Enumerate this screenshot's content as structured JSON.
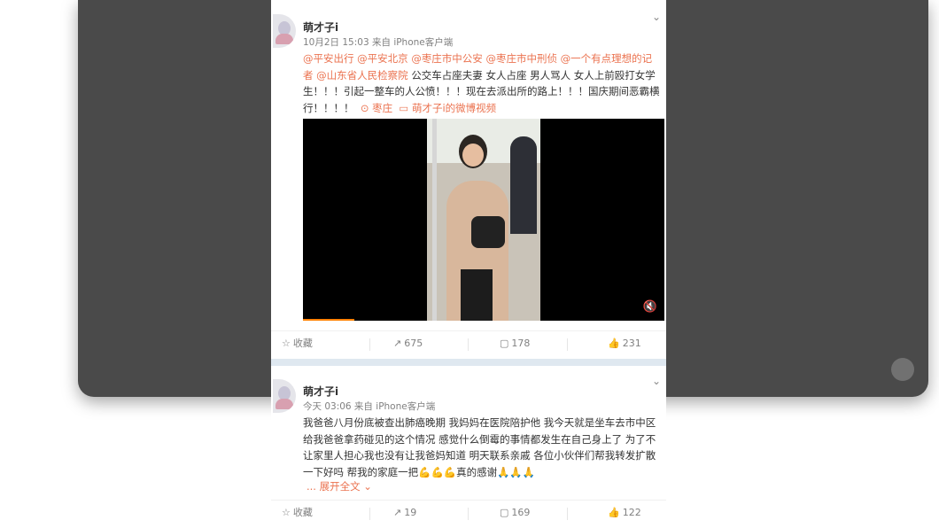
{
  "posts": [
    {
      "author": "萌才子i",
      "meta": "10月2日 15:03 来自 iPhone客户端",
      "mentions": [
        "@平安出行",
        "@平安北京",
        "@枣庄市中公安",
        "@枣庄市中刑侦",
        "@一个有点理想的记者",
        "@山东省人民检察院"
      ],
      "body": "公交车占座夫妻 女人占座 男人骂人 女人上前殴打女学生！！！引起一整车的人公愤！！！现在去派出所的路上！！！国庆期间恶霸横行！！！！",
      "location": "枣庄",
      "video_link": "萌才子i的微博视频",
      "actions": {
        "favorite": "收藏",
        "repost": "675",
        "comment": "178",
        "like": "231"
      }
    },
    {
      "author": "萌才子i",
      "meta": "今天 03:06 来自 iPhone客户端",
      "body": "我爸爸八月份底被查出肺癌晚期 我妈妈在医院陪护他 我今天就是坐车去市中区给我爸爸拿药碰见的这个情况 感觉什么倒霉的事情都发生在自己身上了 为了不让家里人担心我也没有让我爸妈知道 明天联系亲戚 各位小伙伴们帮我转发扩散一下好吗 帮我的家庭一把💪💪💪真的感谢🙏🙏🙏",
      "expand": "... 展开全文",
      "actions": {
        "favorite": "收藏",
        "repost": "19",
        "comment": "169",
        "like": "122"
      }
    }
  ],
  "icons": {
    "favorite": "star-outline-icon",
    "repost": "share-arrow-icon",
    "comment": "comment-bubble-icon",
    "like": "thumbs-up-icon",
    "location": "location-pin-icon",
    "video": "video-icon",
    "volume": "mute-icon",
    "menu": "chevron-down-icon"
  },
  "colors": {
    "accent": "#eb7350",
    "text": "#333333",
    "meta": "#808080"
  }
}
